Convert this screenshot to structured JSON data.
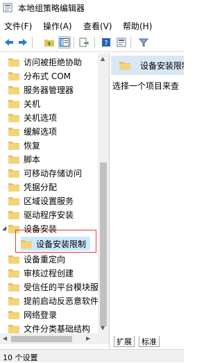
{
  "window": {
    "title": "本地组策略编辑器",
    "title_icon": "policy-editor-icon"
  },
  "menu": {
    "items": [
      "文件(F)",
      "操作(A)",
      "查看(V)",
      "帮助(H)"
    ]
  },
  "toolbar": {
    "buttons": [
      "back-arrow-icon",
      "forward-arrow-icon",
      "up-folder-icon",
      "show-hide-tree-icon",
      "export-list-icon",
      "help-icon",
      "properties-icon",
      "filter-icon"
    ]
  },
  "tree": {
    "items": [
      "访问被拒绝协助",
      "分布式 COM",
      "服务器管理器",
      "关机",
      "关机选项",
      "缓解选项",
      "恢复",
      "脚本",
      "可移动存储访问",
      "凭据分配",
      "区域设置服务",
      "驱动程序安装",
      "设备安装",
      "设备安装限制",
      "设备重定向",
      "审核过程创建",
      "受信任的平台模块服",
      "提前启动反恶意软件",
      "网络登录",
      "文件分类基础结构"
    ],
    "selected": "设备安装限制"
  },
  "right_pane": {
    "header": "设备安装限制",
    "body": "选择一个项目来查"
  },
  "tabs": {
    "items": [
      "扩展",
      "标准"
    ]
  },
  "status": {
    "text": "10 个设置"
  },
  "colors": {
    "folder": "#e8c258",
    "selection": "#cce8ff",
    "callout": "#e33b3b",
    "header_bg": "#d9e7f5"
  }
}
